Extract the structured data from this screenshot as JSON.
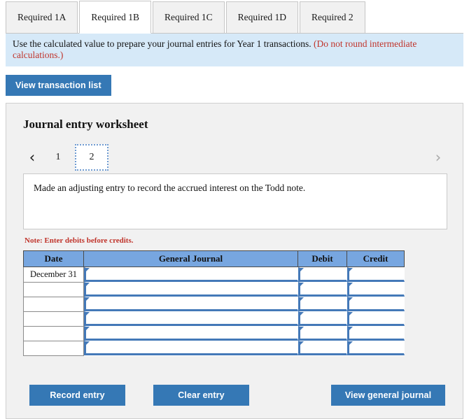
{
  "tabs": [
    {
      "label": "Required 1A",
      "active": false
    },
    {
      "label": "Required 1B",
      "active": true
    },
    {
      "label": "Required 1C",
      "active": false
    },
    {
      "label": "Required 1D",
      "active": false
    },
    {
      "label": "Required 2",
      "active": false
    }
  ],
  "banner": {
    "text": "Use the calculated value to prepare your journal entries for Year 1 transactions. ",
    "warning": "(Do not round intermediate calculations.)"
  },
  "toolbar": {
    "view_transaction_list": "View transaction list"
  },
  "panel": {
    "title": "Journal entry worksheet",
    "pager": {
      "prev_icon": "‹",
      "next_icon": "›",
      "pages": [
        "1",
        "2"
      ],
      "current": "2"
    },
    "description": "Made an adjusting entry to record the accrued interest on the Todd note.",
    "note": "Note: Enter debits before credits."
  },
  "table": {
    "headers": [
      "Date",
      "General Journal",
      "Debit",
      "Credit"
    ],
    "rows": [
      {
        "date": "December 31",
        "general_journal": "",
        "debit": "",
        "credit": ""
      },
      {
        "date": "",
        "general_journal": "",
        "debit": "",
        "credit": ""
      },
      {
        "date": "",
        "general_journal": "",
        "debit": "",
        "credit": ""
      },
      {
        "date": "",
        "general_journal": "",
        "debit": "",
        "credit": ""
      },
      {
        "date": "",
        "general_journal": "",
        "debit": "",
        "credit": ""
      },
      {
        "date": "",
        "general_journal": "",
        "debit": "",
        "credit": ""
      }
    ]
  },
  "footer": {
    "record_entry": "Record entry",
    "clear_entry": "Clear entry",
    "view_general_journal": "View general journal"
  },
  "colors": {
    "button_blue": "#3578b5",
    "header_blue": "#77a6e0",
    "banner_blue": "#d6e9f8",
    "panel_gray": "#f1f1f1",
    "warn_red": "#c0342b",
    "field_blue": "#4479b8"
  }
}
